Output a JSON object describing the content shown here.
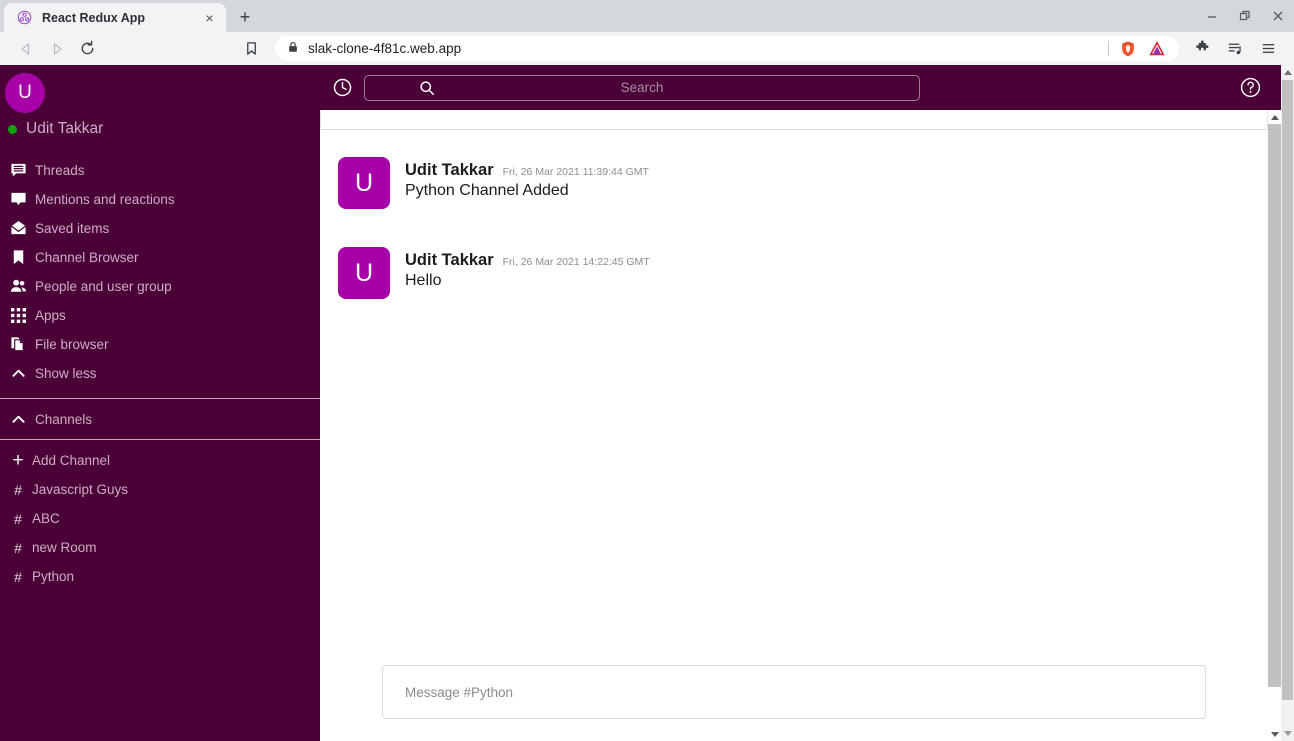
{
  "browser": {
    "tab": {
      "title": "React Redux App",
      "favicon": "react-redux-icon",
      "close_label": "×"
    },
    "new_tab_label": "+",
    "window_controls": {
      "minimize": "—",
      "restore": "❐",
      "close": "✕"
    },
    "nav": {
      "back": "◁",
      "forward": "▷",
      "reload": "↻",
      "bookmark": "bookmark-icon"
    },
    "url": {
      "value": "slak-clone-4f81c.web.app",
      "lock": "lock-icon"
    },
    "toolbar_right": {
      "brave_shield": "brave-shield-icon",
      "brave_logo": "brave-logo-icon",
      "extensions": "puzzle-icon",
      "playlist": "playlist-icon",
      "menu": "hamburger-icon"
    }
  },
  "app": {
    "topbar": {
      "clock_icon": "clock-icon",
      "search_icon": "search-icon",
      "search_placeholder": "Search",
      "help_icon": "help-circle-icon"
    },
    "sidebar": {
      "avatar_initial": "U",
      "username": "Udit Takkar",
      "status": "online",
      "nav_items": [
        {
          "label": "Threads",
          "icon": "threads-icon"
        },
        {
          "label": "Mentions and reactions",
          "icon": "mentions-icon"
        },
        {
          "label": "Saved items",
          "icon": "saved-items-icon"
        },
        {
          "label": "Channel Browser",
          "icon": "bookmark-icon"
        },
        {
          "label": "People and user group",
          "icon": "people-icon"
        },
        {
          "label": "Apps",
          "icon": "apps-grid-icon"
        },
        {
          "label": "File browser",
          "icon": "file-browser-icon"
        },
        {
          "label": "Show less",
          "icon": "chevron-up-icon"
        }
      ],
      "section": {
        "label": "Channels",
        "icon": "chevron-up-icon"
      },
      "add_channel": {
        "label": "Add Channel",
        "icon": "plus-icon"
      },
      "channels": [
        {
          "name": "Javascript Guys",
          "prefix": "#"
        },
        {
          "name": "ABC",
          "prefix": "#"
        },
        {
          "name": "new Room",
          "prefix": "#"
        },
        {
          "name": "Python",
          "prefix": "#"
        }
      ]
    },
    "messages": [
      {
        "avatar_initial": "U",
        "author": "Udit Takkar",
        "time": "Fri, 26 Mar 2021 11:39:44 GMT",
        "text": "Python Channel Added"
      },
      {
        "avatar_initial": "U",
        "author": "Udit Takkar",
        "time": "Fri, 26 Mar 2021 14:22:45 GMT",
        "text": "Hello"
      }
    ],
    "composer": {
      "placeholder": "Message #Python"
    }
  },
  "colors": {
    "sidebar_bg": "#4a0037",
    "avatar": "#a800a8",
    "status_online": "#13a10e",
    "sidebar_text": "#cfaec4"
  }
}
